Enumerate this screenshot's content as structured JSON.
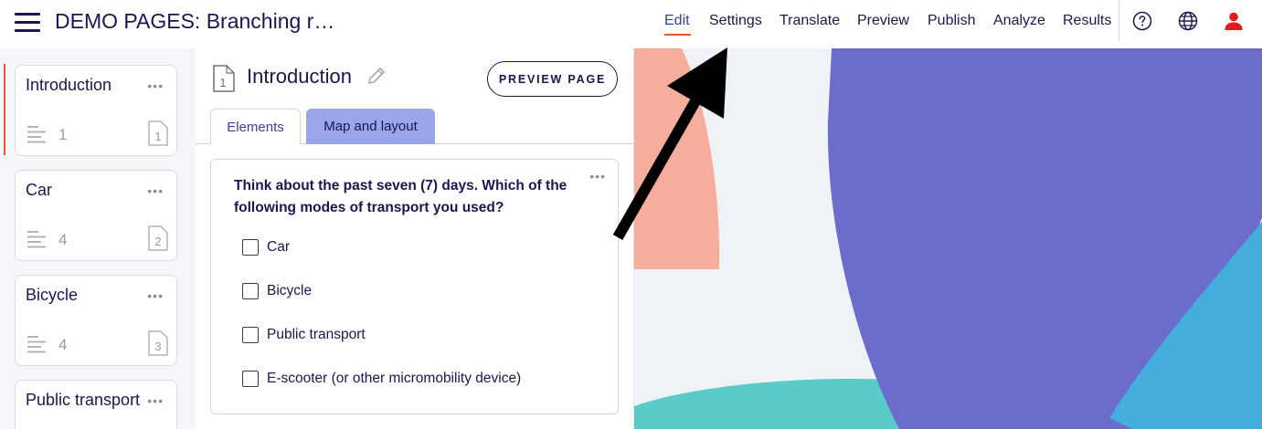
{
  "header": {
    "title": "DEMO PAGES: Branching r…",
    "nav": [
      {
        "label": "Edit"
      },
      {
        "label": "Settings"
      },
      {
        "label": "Translate"
      },
      {
        "label": "Preview"
      },
      {
        "label": "Publish"
      },
      {
        "label": "Analyze"
      },
      {
        "label": "Results"
      }
    ],
    "icons": [
      "help-icon",
      "globe-icon",
      "user-icon"
    ]
  },
  "sidebar": {
    "pages": [
      {
        "name": "Introduction",
        "count": "1",
        "page_number": "1"
      },
      {
        "name": "Car",
        "count": "4",
        "page_number": "2"
      },
      {
        "name": "Bicycle",
        "count": "4",
        "page_number": "3"
      },
      {
        "name": "Public transport"
      }
    ]
  },
  "editor": {
    "title": "Introduction",
    "page_number": "1",
    "preview_label": "PREVIEW PAGE",
    "tabs": [
      {
        "label": "Elements"
      },
      {
        "label": "Map and layout"
      }
    ],
    "question": {
      "text": "Think about the past seven (7) days. Which of the following modes of transport you used?",
      "options": [
        {
          "label": "Car"
        },
        {
          "label": "Bicycle"
        },
        {
          "label": "Public transport"
        },
        {
          "label": "E-scooter (or other micromobility device)"
        }
      ]
    }
  },
  "colors": {
    "accent": "#e8552d",
    "brand_navy": "#1c1650",
    "tab_active_bg": "#99a6ea",
    "shape_purple": "#6b6ccb",
    "shape_teal": "#59cbc8",
    "shape_blue": "#45aedd",
    "shape_salmon": "#f7ad9c",
    "user_icon_red": "#e31b1b"
  }
}
